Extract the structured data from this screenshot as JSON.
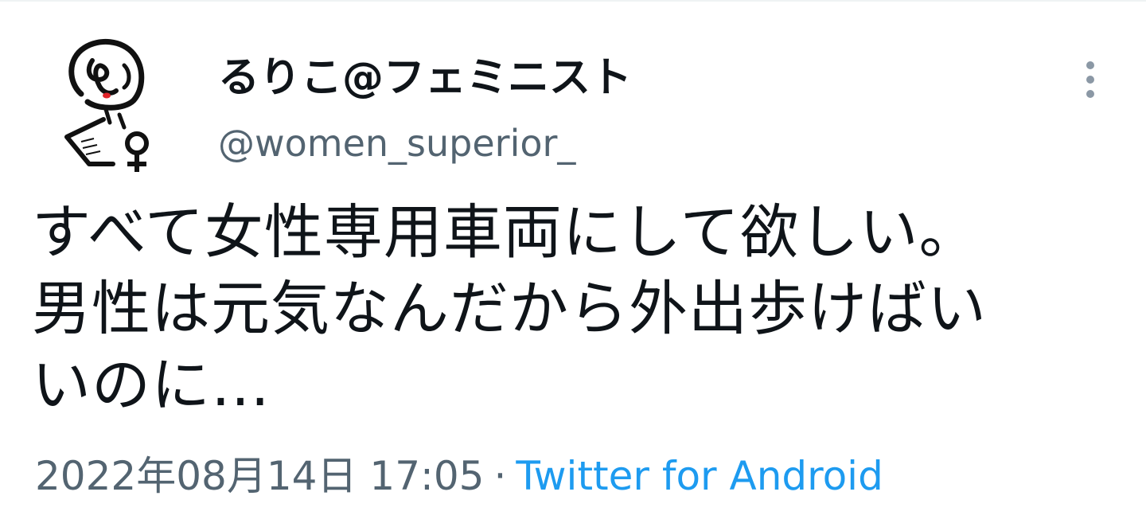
{
  "tweet": {
    "author": {
      "display_name": "るりこ@フェミニスト",
      "handle": "@women_superior_",
      "avatar_icon": "female-symbol-portrait-icon"
    },
    "more_icon": "vertical-ellipsis-icon",
    "text_lines": [
      "すべて女性専用車両にして欲しい。",
      "男性は元気なんだから外出歩けばい",
      "いのに…"
    ],
    "timestamp": "2022年08月14日 17:05",
    "separator": "·",
    "source": "Twitter for Android",
    "colors": {
      "text": "#0f1419",
      "secondary": "#536471",
      "link": "#1d9bf0",
      "avatar_lips": "#e0242a"
    }
  }
}
